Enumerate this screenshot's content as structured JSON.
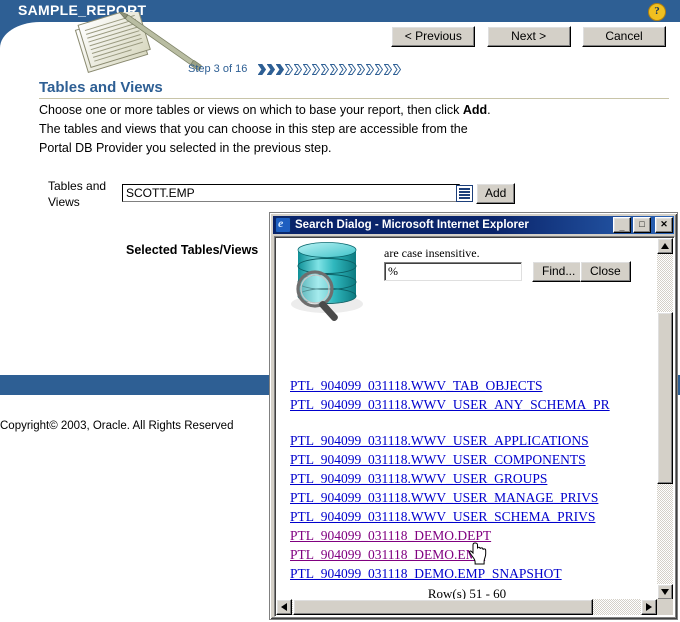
{
  "page": {
    "header_title": "SAMPLE_REPORT",
    "help_icon": "help-icon",
    "buttons": {
      "previous": "< Previous",
      "next": "Next >",
      "cancel": "Cancel"
    },
    "step_label": "Step 3 of 16",
    "step_current": 3,
    "step_total": 16,
    "section_title": "Tables and Views",
    "section_desc_line1": "Choose one or more tables or views on which to base your report, then click ",
    "section_desc_bold": "Add",
    "section_desc_line1_end": ".",
    "section_desc_line2": "The tables and views that you can choose in this step are accessible from the",
    "section_desc_line3": "Portal DB Provider you selected in the previous step.",
    "field_label": "Tables and Views",
    "field_value": "SCOTT.EMP",
    "lov_icon": "list-of-values-icon",
    "add_button": "Add",
    "selected_label": "Selected Tables/Views",
    "copyright": "Copyright© 2003, Oracle. All Rights Reserved",
    "accent_color": "#2e5f94"
  },
  "dialog": {
    "title": "Search Dialog - Microsoft Internet Explorer",
    "app_icon": "internet-explorer-icon",
    "minimize": "_",
    "maximize": "□",
    "close": "✕",
    "search_hint": "are case insensitive.",
    "search_value": "%",
    "find_button": "Find...",
    "close_button": "Close",
    "db_search_icon": "database-magnifier-icon",
    "results": [
      {
        "text": "PTL_904099_031118.WWV_TAB_OBJECTS",
        "visited": false
      },
      {
        "text": "PTL_904099_031118.WWV_USER_ANY_SCHEMA_PR",
        "visited": false
      },
      {
        "text": "PTL_904099_031118.WWV_USER_APPLICATIONS",
        "visited": false
      },
      {
        "text": "PTL_904099_031118.WWV_USER_COMPONENTS",
        "visited": false
      },
      {
        "text": "PTL_904099_031118.WWV_USER_GROUPS",
        "visited": false
      },
      {
        "text": "PTL_904099_031118.WWV_USER_MANAGE_PRIVS",
        "visited": false
      },
      {
        "text": "PTL_904099_031118.WWV_USER_SCHEMA_PRIVS",
        "visited": false
      },
      {
        "text": "PTL_904099_031118_DEMO.DEPT",
        "visited": true
      },
      {
        "text": "PTL_904099_031118_DEMO.EMP",
        "visited": true
      },
      {
        "text": "PTL_904099_031118_DEMO.EMP_SNAPSHOT",
        "visited": false
      }
    ],
    "row_info": "Row(s) 51 - 60",
    "link_color": "#0000cc",
    "visited_link_color": "#800080",
    "titlebar_color": "#0a246a"
  }
}
